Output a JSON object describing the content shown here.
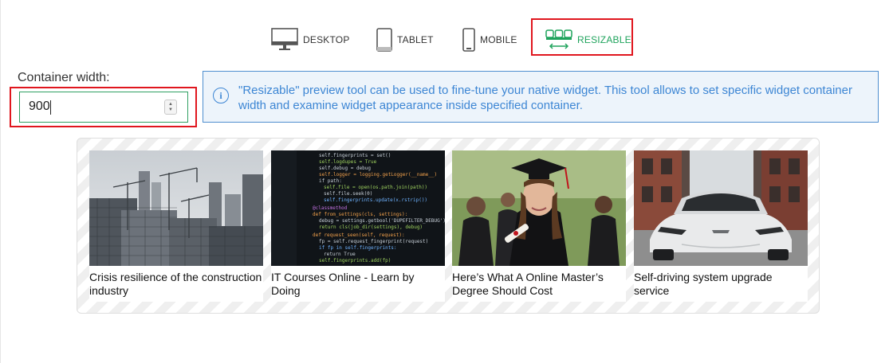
{
  "device_tabs": {
    "desktop": "DESKTOP",
    "tablet": "TABLET",
    "mobile": "MOBILE",
    "resizable": "RESIZABLE"
  },
  "colors": {
    "accent_green": "#1fa35c",
    "highlight_red": "#e0161e",
    "info_blue": "#3d86d4"
  },
  "container_width": {
    "label": "Container width:",
    "value": "900"
  },
  "info": {
    "icon": "info-icon",
    "text": "\"Resizable\" preview tool can be used to fine-tune your native widget. This tool allows to set specific widget container width and examine widget appearance inside specified container."
  },
  "widget": {
    "cards": [
      {
        "title": "Crisis resilience of the construction industry"
      },
      {
        "title": "IT Courses Online - Learn by Doing"
      },
      {
        "title": "Here’s What A Online Master’s Degree Should Cost"
      },
      {
        "title": "Self-driving system upgrade service"
      }
    ]
  }
}
